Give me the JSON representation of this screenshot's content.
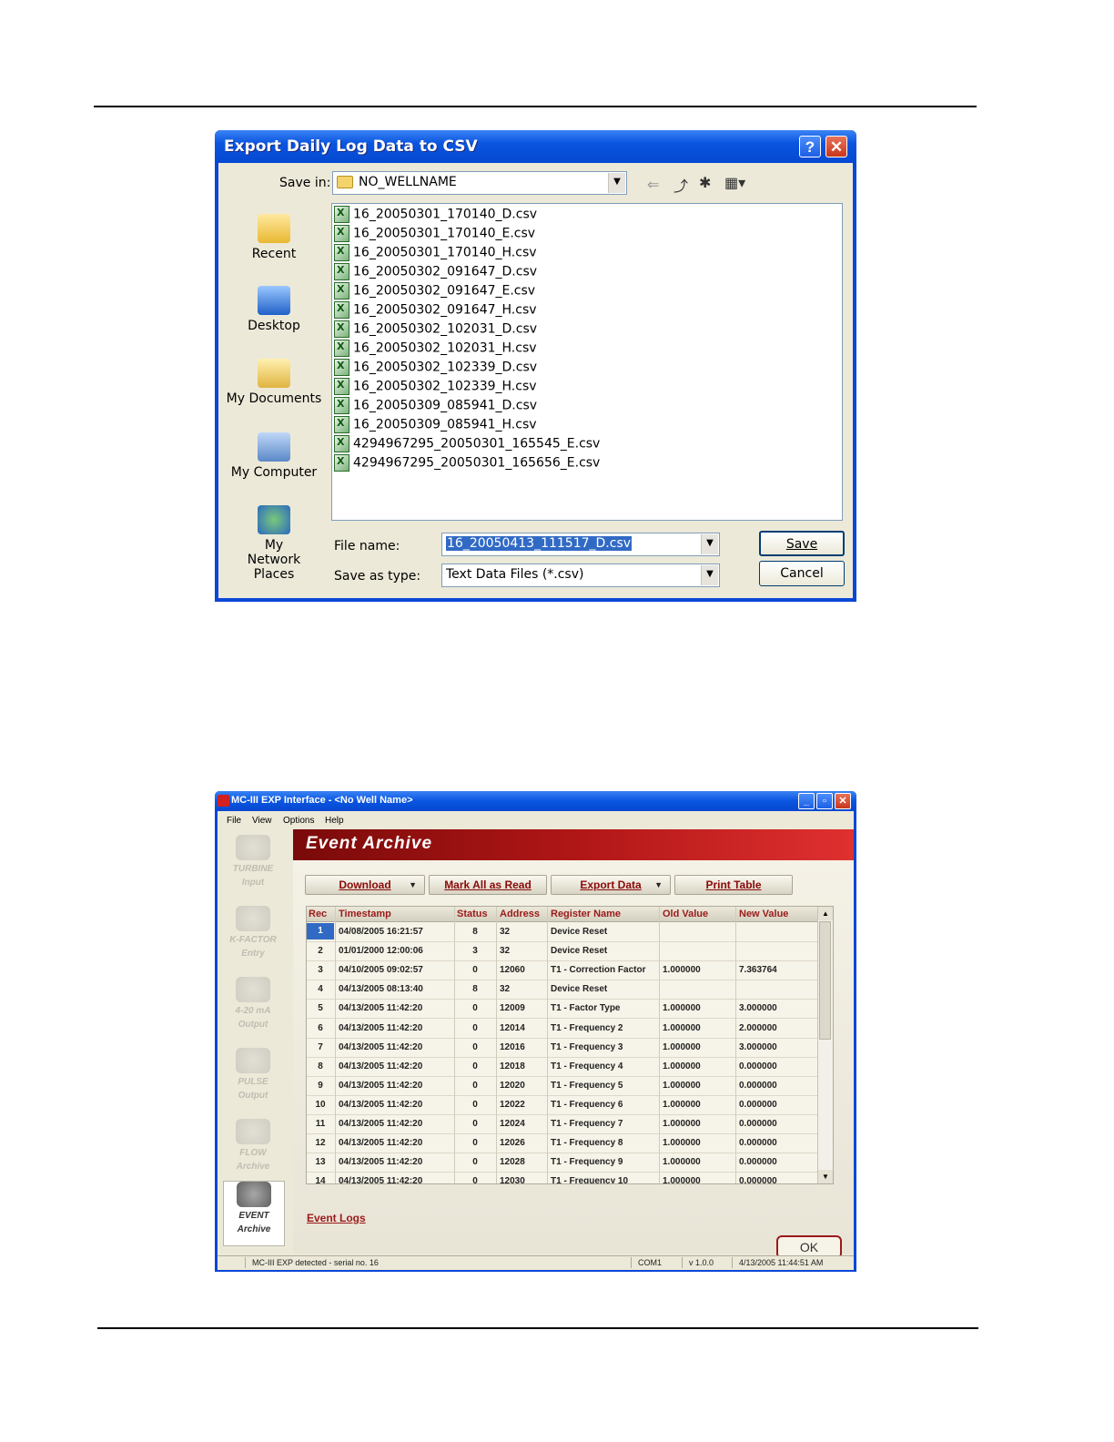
{
  "dialog": {
    "title": "Export Daily Log Data to CSV",
    "save_in_label": "Save in:",
    "save_in_value": "NO_WELLNAME",
    "places": [
      {
        "label": "Recent",
        "icon": "recent-folder-icon"
      },
      {
        "label": "Desktop",
        "icon": "desktop-icon"
      },
      {
        "label": "My Documents",
        "icon": "my-documents-icon"
      },
      {
        "label": "My Computer",
        "icon": "my-computer-icon"
      },
      {
        "label": "My Network Places",
        "icon": "network-icon"
      }
    ],
    "files": [
      "16_20050301_170140_D.csv",
      "16_20050301_170140_E.csv",
      "16_20050301_170140_H.csv",
      "16_20050302_091647_D.csv",
      "16_20050302_091647_E.csv",
      "16_20050302_091647_H.csv",
      "16_20050302_102031_D.csv",
      "16_20050302_102031_H.csv",
      "16_20050302_102339_D.csv",
      "16_20050302_102339_H.csv",
      "16_20050309_085941_D.csv",
      "16_20050309_085941_H.csv",
      "4294967295_20050301_165545_E.csv",
      "4294967295_20050301_165656_E.csv"
    ],
    "file_name_label": "File name:",
    "file_name_value": "16_20050413_111517_D.csv",
    "save_as_type_label": "Save as type:",
    "save_as_type_value": "Text Data Files (*.csv)",
    "save_button": "Save",
    "cancel_button": "Cancel"
  },
  "app": {
    "title": "MC-III EXP Interface - <No Well Name>",
    "menu": [
      "File",
      "View",
      "Options",
      "Help"
    ],
    "sidebar": [
      {
        "line1": "TURBINE",
        "line2": "Input"
      },
      {
        "line1": "K-FACTOR",
        "line2": "Entry"
      },
      {
        "line1": "4-20 mA",
        "line2": "Output"
      },
      {
        "line1": "PULSE",
        "line2": "Output"
      },
      {
        "line1": "FLOW",
        "line2": "Archive"
      },
      {
        "line1": "EVENT",
        "line2": "Archive"
      }
    ],
    "banner_title": "Event Archive",
    "buttons": {
      "download": "Download",
      "mark_all": "Mark All as Read",
      "export": "Export Data",
      "print": "Print Table"
    },
    "columns": [
      "Rec",
      "Timestamp",
      "Status",
      "Address",
      "Register Name",
      "Old Value",
      "New Value"
    ],
    "rows": [
      [
        "1",
        "04/08/2005 16:21:57",
        "8",
        "32",
        "Device Reset",
        "",
        ""
      ],
      [
        "2",
        "01/01/2000 12:00:06",
        "3",
        "32",
        "Device Reset",
        "",
        ""
      ],
      [
        "3",
        "04/10/2005 09:02:57",
        "0",
        "12060",
        "T1 - Correction Factor",
        "1.000000",
        "7.363764"
      ],
      [
        "4",
        "04/13/2005 08:13:40",
        "8",
        "32",
        "Device Reset",
        "",
        ""
      ],
      [
        "5",
        "04/13/2005 11:42:20",
        "0",
        "12009",
        "T1 - Factor Type",
        "1.000000",
        "3.000000"
      ],
      [
        "6",
        "04/13/2005 11:42:20",
        "0",
        "12014",
        "T1 - Frequency 2",
        "1.000000",
        "2.000000"
      ],
      [
        "7",
        "04/13/2005 11:42:20",
        "0",
        "12016",
        "T1 - Frequency 3",
        "1.000000",
        "3.000000"
      ],
      [
        "8",
        "04/13/2005 11:42:20",
        "0",
        "12018",
        "T1 - Frequency 4",
        "1.000000",
        "0.000000"
      ],
      [
        "9",
        "04/13/2005 11:42:20",
        "0",
        "12020",
        "T1 - Frequency 5",
        "1.000000",
        "0.000000"
      ],
      [
        "10",
        "04/13/2005 11:42:20",
        "0",
        "12022",
        "T1 - Frequency 6",
        "1.000000",
        "0.000000"
      ],
      [
        "11",
        "04/13/2005 11:42:20",
        "0",
        "12024",
        "T1 - Frequency 7",
        "1.000000",
        "0.000000"
      ],
      [
        "12",
        "04/13/2005 11:42:20",
        "0",
        "12026",
        "T1 - Frequency 8",
        "1.000000",
        "0.000000"
      ],
      [
        "13",
        "04/13/2005 11:42:20",
        "0",
        "12028",
        "T1 - Frequency 9",
        "1.000000",
        "0.000000"
      ],
      [
        "14",
        "04/13/2005 11:42:20",
        "0",
        "12030",
        "T1 - Frequency 10",
        "1.000000",
        "0.000000"
      ]
    ],
    "tab_label": "Event Logs",
    "ok_button": "OK",
    "status": {
      "device": "MC-III EXP detected - serial no. 16",
      "port": "COM1",
      "version": "v 1.0.0",
      "datetime": "4/13/2005 11:44:51 AM"
    }
  }
}
